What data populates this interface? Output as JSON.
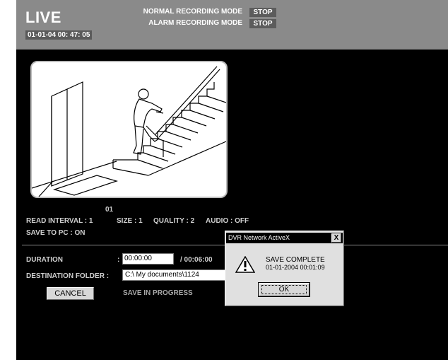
{
  "header": {
    "title": "LIVE",
    "clock": "01-01-04  00: 47: 05",
    "normal_mode_label": "NORMAL RECORDING MODE",
    "normal_mode_status": "STOP",
    "alarm_mode_label": "ALARM RECORDING MODE",
    "alarm_mode_status": "STOP"
  },
  "camera": {
    "number": "01",
    "read_interval": "READ INTERVAL : 1",
    "size": "SIZE : 1",
    "quality": "QUALITY : 2",
    "audio": "AUDIO : OFF",
    "save_to_pc": "SAVE TO PC     : ON"
  },
  "save_form": {
    "duration_label": "DURATION",
    "duration_colon": ":",
    "duration_value": "00:00:00",
    "duration_total": "/ 00:06:00",
    "destination_label": "DESTINATION FOLDER :",
    "destination_value": "C:\\ My documents\\1124",
    "cancel_label": "CANCEL",
    "progress_text": "SAVE IN PROGRESS"
  },
  "dialog": {
    "title": "DVR Network ActiveX",
    "close_label": "X",
    "message": "SAVE COMPLETE",
    "detail": "01-01-2004 00:01:09",
    "ok_label": "OK"
  },
  "colors": {
    "background": "#000000",
    "header": "#8a8a8a",
    "dialog": "#e0e0e0"
  },
  "icons": {
    "warning": "warning-icon",
    "close": "close-icon"
  }
}
